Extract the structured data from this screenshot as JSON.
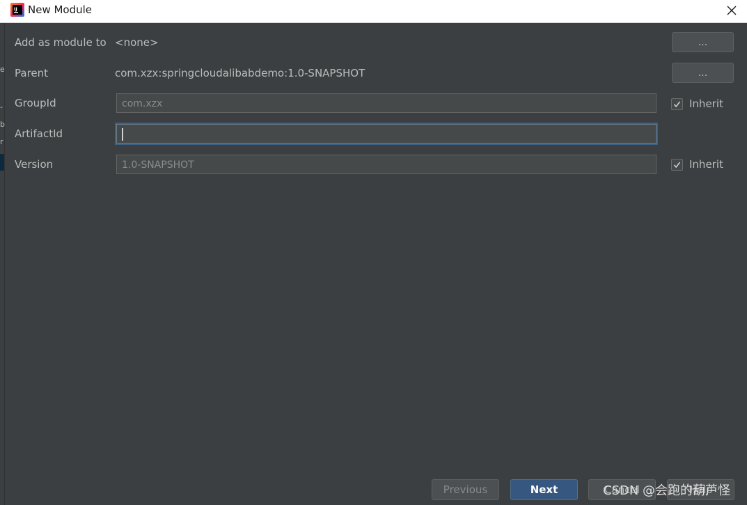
{
  "window": {
    "title": "New Module",
    "icon": "intellij-idea-icon",
    "close_icon": "close-icon"
  },
  "background_fragments": [
    "e",
    "-",
    "b",
    "r"
  ],
  "form": {
    "add_as_module_to": {
      "label": "Add as module to",
      "value": "<none>",
      "button_label": "..."
    },
    "parent": {
      "label": "Parent",
      "value": "com.xzx:springcloudalibabdemo:1.0-SNAPSHOT",
      "button_label": "..."
    },
    "group_id": {
      "label": "GroupId",
      "value": "com.xzx",
      "inherit_label": "Inherit",
      "inherit_checked": true
    },
    "artifact_id": {
      "label": "ArtifactId",
      "value": ""
    },
    "version": {
      "label": "Version",
      "value": "1.0-SNAPSHOT",
      "inherit_label": "Inherit",
      "inherit_checked": true
    }
  },
  "footer": {
    "previous_label": "Previous",
    "next_label": "Next",
    "cancel_label": "Cancel",
    "help_label": "Help"
  },
  "watermark": "CSDN @会跑的葫芦怪",
  "colors": {
    "dialog_bg": "#3c3f41",
    "primary_button": "#365880",
    "focus_border": "#3d6185"
  }
}
